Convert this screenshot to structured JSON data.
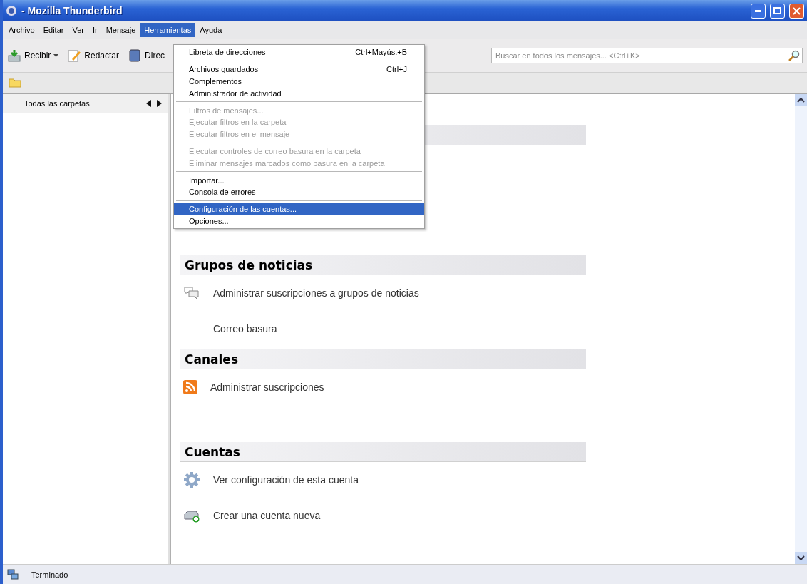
{
  "window": {
    "title": "- Mozilla Thunderbird"
  },
  "menubar": [
    {
      "label": "Archivo",
      "selected": false
    },
    {
      "label": "Editar",
      "selected": false
    },
    {
      "label": "Ver",
      "selected": false
    },
    {
      "label": "Ir",
      "selected": false
    },
    {
      "label": "Mensaje",
      "selected": false
    },
    {
      "label": "Herramientas",
      "selected": true
    },
    {
      "label": "Ayuda",
      "selected": false
    }
  ],
  "toolbar": [
    {
      "label": "Recibir",
      "kind": "get"
    },
    {
      "label": "Redactar",
      "kind": "write"
    },
    {
      "label": "Direc",
      "kind": "book"
    }
  ],
  "search": {
    "placeholder": "Buscar en todos los mensajes... <Ctrl+K>"
  },
  "sidebar": {
    "header": "Todas las carpetas"
  },
  "menu": [
    {
      "kind": "item",
      "label": "Libreta de direcciones",
      "shortcut": "Ctrl+Mayús.+B",
      "disabled": false,
      "selected": false
    },
    {
      "kind": "separator"
    },
    {
      "kind": "item",
      "label": "Archivos guardados",
      "shortcut": "Ctrl+J",
      "disabled": false,
      "selected": false
    },
    {
      "kind": "item",
      "label": "Complementos",
      "disabled": false,
      "selected": false
    },
    {
      "kind": "item",
      "label": "Administrador de actividad",
      "disabled": false,
      "selected": false
    },
    {
      "kind": "separator"
    },
    {
      "kind": "item",
      "label": "Filtros de mensajes...",
      "disabled": true,
      "selected": false
    },
    {
      "kind": "item",
      "label": "Ejecutar filtros en la carpeta",
      "disabled": true,
      "selected": false
    },
    {
      "kind": "item",
      "label": "Ejecutar filtros en el mensaje",
      "disabled": true,
      "selected": false
    },
    {
      "kind": "separator"
    },
    {
      "kind": "item",
      "label": "Ejecutar controles de correo basura en la carpeta",
      "disabled": true,
      "selected": false
    },
    {
      "kind": "item",
      "label": "Eliminar mensajes marcados como basura en la carpeta",
      "disabled": true,
      "selected": false
    },
    {
      "kind": "separator"
    },
    {
      "kind": "item",
      "label": "Importar...",
      "disabled": false,
      "selected": false
    },
    {
      "kind": "item",
      "label": "Consola de errores",
      "disabled": false,
      "selected": false
    },
    {
      "kind": "separator"
    },
    {
      "kind": "item",
      "label": "Configuración de las cuentas...",
      "disabled": false,
      "selected": true
    },
    {
      "kind": "item",
      "label": "Opciones...",
      "disabled": false,
      "selected": false
    }
  ],
  "sections": [
    {
      "title": "Grupos de noticias",
      "items": [
        {
          "label": "Administrar suscripciones a grupos de noticias",
          "kind": "chat"
        },
        {
          "label": "Correo basura",
          "kind": "plain"
        }
      ]
    },
    {
      "title": "Canales",
      "items": [
        {
          "label": "Administrar suscripciones",
          "kind": "rss"
        }
      ]
    },
    {
      "title": "Cuentas",
      "items": [
        {
          "label": "Ver configuración de esta cuenta",
          "kind": "gear"
        },
        {
          "label": "Crear una cuenta nueva",
          "kind": "account-add"
        }
      ]
    }
  ],
  "status_bar": {
    "text": "Terminado"
  }
}
